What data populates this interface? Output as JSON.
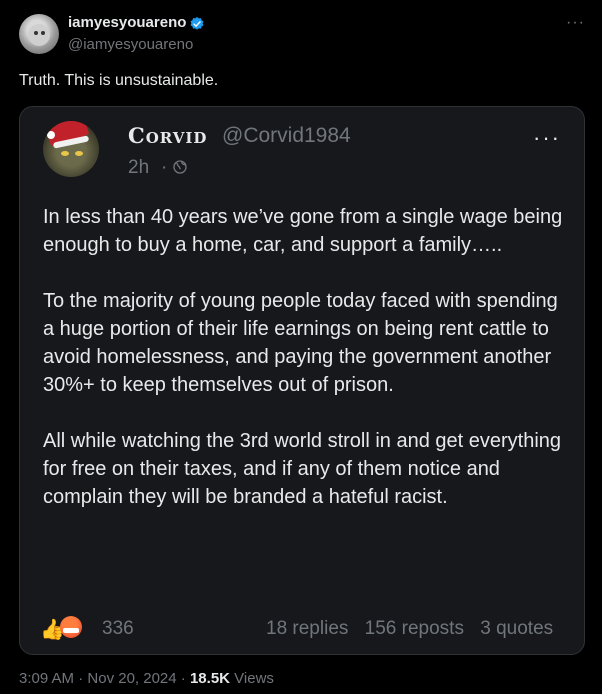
{
  "author": {
    "name": "iamyesyouareno",
    "handle": "@iamyesyouareno",
    "verified": true,
    "accent": "#1d9bf0"
  },
  "tweet": {
    "text": "Truth. This is unsustainable.",
    "more_label": "···"
  },
  "quote": {
    "name": "Corvid",
    "handle": "@Corvid1984",
    "time": "2h",
    "separator": "·",
    "more_label": "···",
    "paragraphs": [
      "In less than 40 years we’ve gone from a single wage being enough to buy a home, car, and support a family…..",
      "To the majority of young people today faced with spending a huge portion of their life earnings on being rent cattle to avoid homelessness, and paying the government another 30%+ to keep themselves out of prison.",
      "All while watching the 3rd world stroll in and get everything for free on their taxes, and if any of them notice and complain they will be branded a hateful racist."
    ],
    "reaction_count": "336",
    "replies": "18 replies",
    "reposts": "156 reposts",
    "quotes": "3 quotes"
  },
  "footer": {
    "time": "3:09 AM",
    "sep1": "·",
    "date": "Nov 20, 2024",
    "sep2": "·",
    "views_count": "18.5K",
    "views_label": "Views"
  }
}
